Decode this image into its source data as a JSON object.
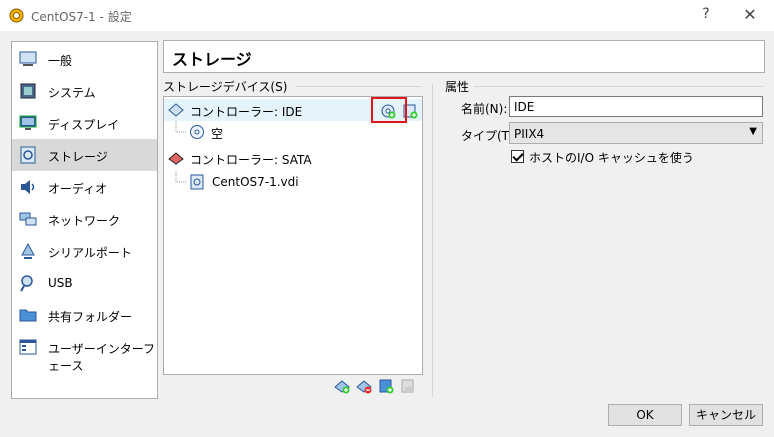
{
  "window": {
    "title": "CentOS7-1 - 設定",
    "help": "?",
    "close": "✕"
  },
  "sidebar": {
    "items": [
      {
        "label": "一般",
        "icon": "general-icon"
      },
      {
        "label": "システム",
        "icon": "system-icon"
      },
      {
        "label": "ディスプレイ",
        "icon": "display-icon"
      },
      {
        "label": "ストレージ",
        "icon": "storage-icon",
        "selected": true
      },
      {
        "label": "オーディオ",
        "icon": "audio-icon"
      },
      {
        "label": "ネットワーク",
        "icon": "network-icon"
      },
      {
        "label": "シリアルポート",
        "icon": "serial-port-icon"
      },
      {
        "label": "USB",
        "icon": "usb-icon"
      },
      {
        "label": "共有フォルダー",
        "icon": "shared-folder-icon"
      },
      {
        "label": "ユーザーインターフェース",
        "icon": "user-interface-icon"
      }
    ]
  },
  "page": {
    "title": "ストレージ"
  },
  "storage": {
    "group_label": "ストレージデバイス(S)",
    "tree": [
      {
        "label": "コントローラー: IDE",
        "type": "controller"
      },
      {
        "label": "空",
        "type": "optical"
      },
      {
        "label": "コントローラー: SATA",
        "type": "controller"
      },
      {
        "label": "CentOS7-1.vdi",
        "type": "disk"
      }
    ]
  },
  "attributes": {
    "group_label": "属性",
    "name_label": "名前(N):",
    "name_value": "IDE",
    "type_label": "タイプ(T):",
    "type_value": "PIIX4",
    "io_cache_label": "ホストのI/O キャッシュを使う",
    "io_cache_checked": true
  },
  "buttons": {
    "ok": "OK",
    "cancel": "キャンセル"
  },
  "colors": {
    "highlight_box": "#e0141a",
    "selection": "#d9d9d9"
  }
}
